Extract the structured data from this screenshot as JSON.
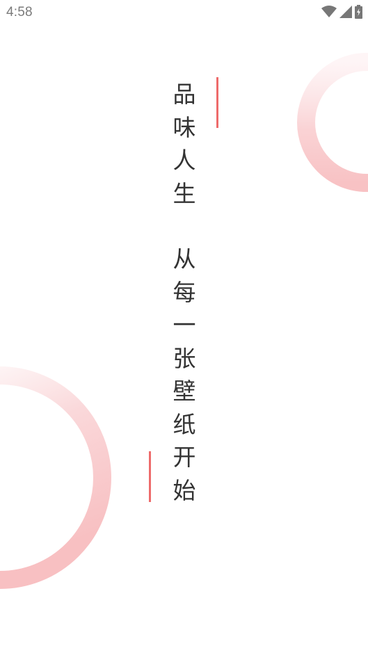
{
  "status_bar": {
    "time": "4:58",
    "icons": [
      "wifi-icon",
      "signal-icon",
      "battery-charging-icon"
    ]
  },
  "slogan": {
    "line1": "品味人生",
    "line2": "从每一张壁纸开始"
  },
  "colors": {
    "accent": "#ee6b6b",
    "ring": "#f9c6c8",
    "text": "#333333",
    "status_text": "#7a7a7a"
  }
}
